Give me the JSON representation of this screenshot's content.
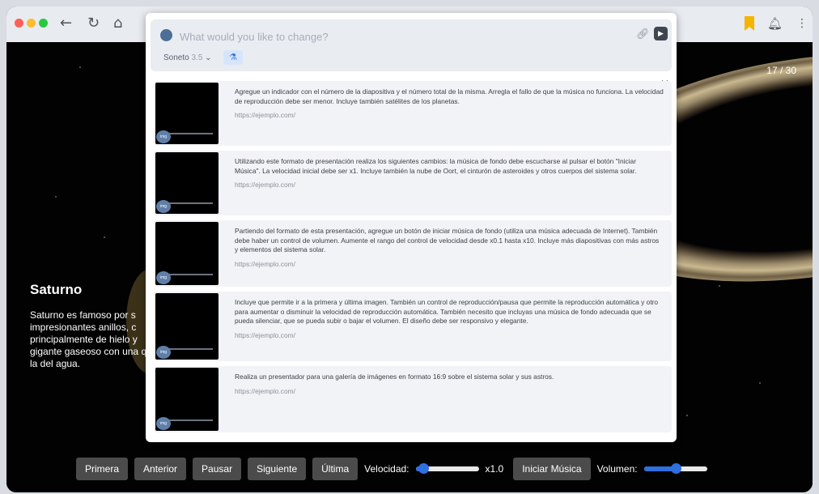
{
  "browser": {
    "dot_colors": [
      "#ff5f57",
      "#febc2e",
      "#28c840"
    ],
    "back_icon": "arrow-left-icon",
    "reload_icon": "reload-icon",
    "home_icon": "home-icon",
    "bookmark_color": "#f5b400"
  },
  "slide": {
    "counter": "17 / 30",
    "title": "Saturno",
    "text": "Saturno es famoso por s impresionantes anillos, c principalmente de hielo y gigante gaseoso con una que la del agua."
  },
  "controls": {
    "first": "Primera",
    "prev": "Anterior",
    "pause": "Pausar",
    "next": "Siguiente",
    "last": "Última",
    "speed_label": "Velocidad:",
    "speed_value": "x1.0",
    "speed_level": 0.12,
    "music": "Iniciar Música",
    "volume_label": "Volumen:",
    "volume_level": 0.5,
    "accent": "#2f6fe0"
  },
  "panel": {
    "prompt_placeholder": "What would you like to change?",
    "model_name": "Soneto",
    "model_version": "3.5",
    "close": "×",
    "history": [
      {
        "text": "Agregue un indicador con el número de la diapositiva y el número total de la misma. Arregla el fallo de que la música no funciona. La velocidad de reproducción debe ser menor. Incluye también satélites de los planetas.",
        "url": "https://ejemplo.com/"
      },
      {
        "text": "Utilizando este formato de presentación realiza los siguientes cambios: la música de fondo debe escucharse al pulsar el botón \"Iniciar Música\". La velocidad inicial debe ser x1. Incluye también la nube de Oort, el cinturón de asteroides y otros cuerpos del sistema solar.",
        "url": "https://ejemplo.com/"
      },
      {
        "text": "Partiendo del formato de esta presentación, agregue un botón de iniciar música de fondo (utiliza una música adecuada de Internet). También debe haber un control de volumen. Aumente el rango del control de velocidad desde x0.1 hasta x10. Incluye más diapositivas con más astros y elementos del sistema solar.",
        "url": "https://ejemplo.com/"
      },
      {
        "text": "Incluye que permite ir a la primera y última imagen. También un control de reproducción/pausa que permite la reproducción automática y otro para aumentar o disminuir la velocidad de reproducción automática. También necesito que incluyas una música de fondo adecuada que se pueda silenciar, que se pueda subir o bajar el volumen. El diseño debe ser responsivo y elegante.",
        "url": "https://ejemplo.com/"
      },
      {
        "text": "Realiza un presentador para una galería de imágenes en formato 16:9 sobre el sistema solar y sus astros.",
        "url": "https://ejemplo.com/"
      }
    ]
  }
}
